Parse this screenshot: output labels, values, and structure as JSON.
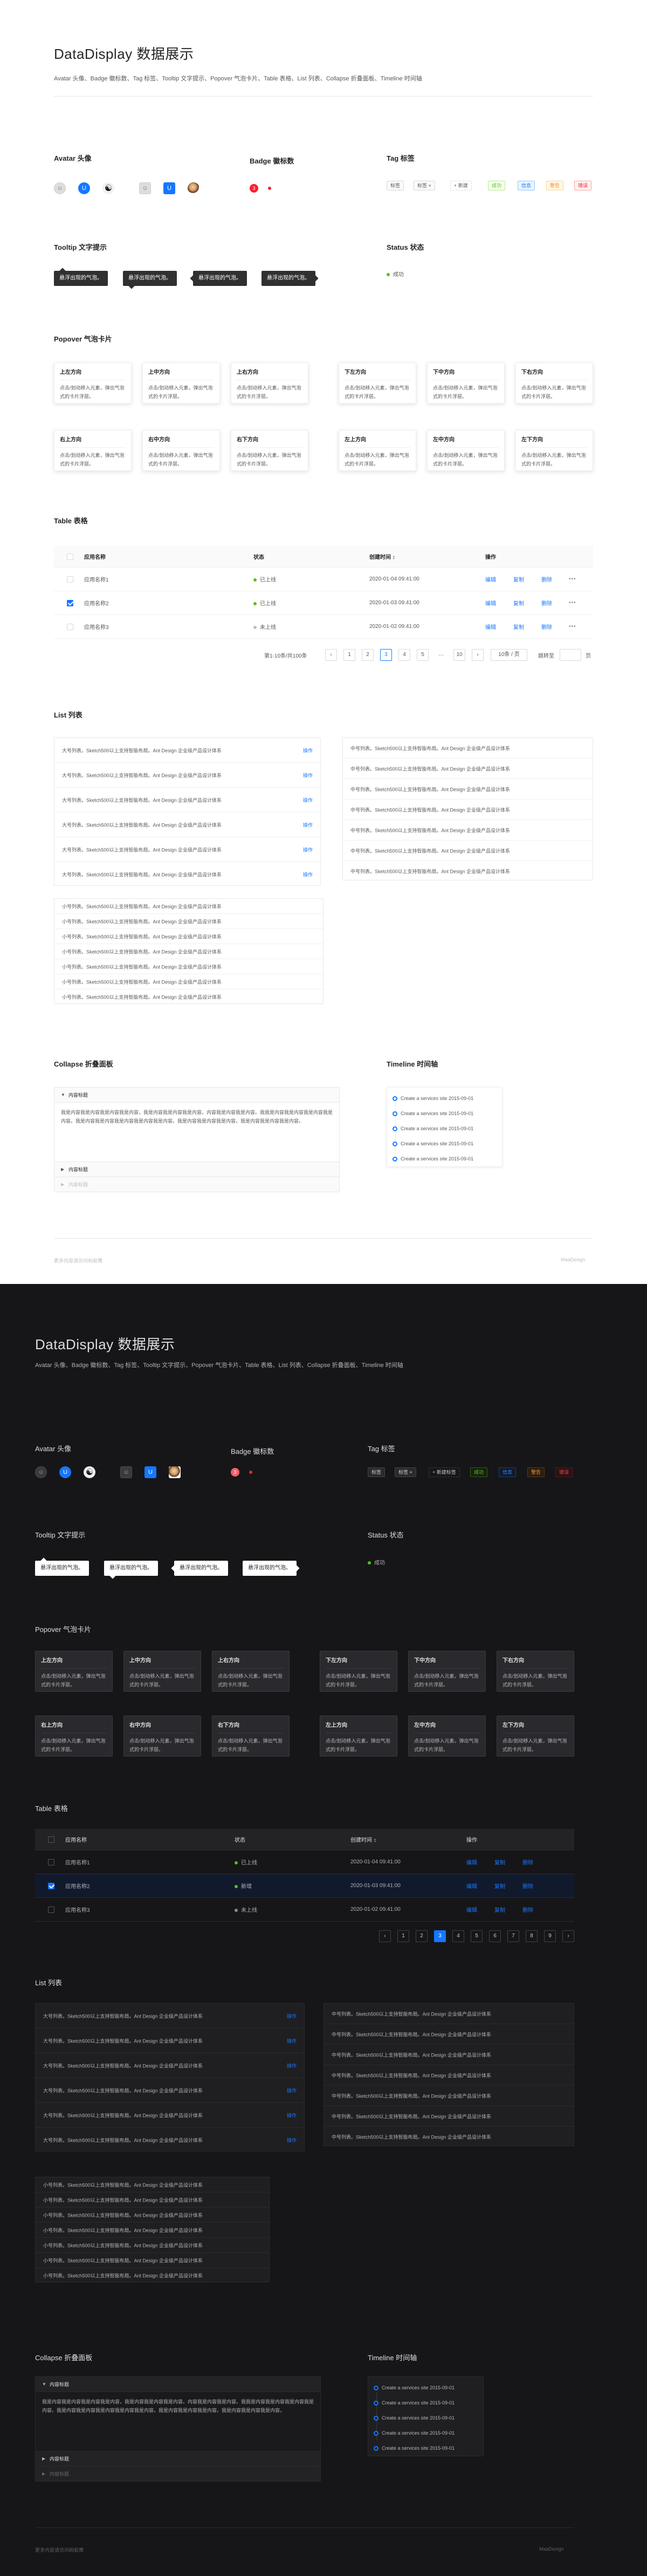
{
  "page": {
    "title": "DataDisplay 数据展示",
    "subtitle": "Avatar 头像、Badge 徽标数、Tag 标签、Tooltip 文字提示、Popover 气泡卡片、Table 表格、List 列表、Collapse 折叠面板、Timeline 时间轴"
  },
  "sections": {
    "avatar": "Avatar 头像",
    "badge": "Badge 徽标数",
    "tag": "Tag 标签",
    "tooltip": "Tooltip 文字提示",
    "status": "Status 状态",
    "popover": "Popover 气泡卡片",
    "table": "Table 表格",
    "list": "List 列表",
    "collapse": "Collapse 折叠面板",
    "timeline": "Timeline 时间轴"
  },
  "avatar": {
    "letter": "U",
    "icons": [
      "user-icon",
      "yin-yang-icon",
      "photo-avatar"
    ]
  },
  "badge": {
    "count": "3"
  },
  "tags": {
    "light": [
      "标签",
      "标签 ×",
      "+ 新建",
      "成功",
      "信息",
      "警告",
      "错误"
    ],
    "dark": [
      "标签",
      "标签 ×",
      "+ 新建标签",
      "成功",
      "信息",
      "警告",
      "错误"
    ]
  },
  "tooltip": {
    "text": "悬浮出现的气泡。"
  },
  "status": {
    "text": "成功",
    "color": "#52c41a"
  },
  "popover": {
    "titles": [
      "上左方向",
      "上中方向",
      "上右方向",
      "下左方向",
      "下中方向",
      "下右方向",
      "右上方向",
      "右中方向",
      "右下方向",
      "左上方向",
      "左中方向",
      "左下方向"
    ],
    "desc": "点击/划动移入元素，弹出气泡式的卡片浮层。"
  },
  "table": {
    "headers": [
      "应用名称",
      "状态",
      "创建时间",
      "操作"
    ],
    "sort_icon": "↕",
    "rows": [
      {
        "name": "应用名称1",
        "status": "已上线",
        "status_color": "#52c41a",
        "time": "2020-01-04  09:41:00",
        "selected": false
      },
      {
        "name": "应用名称2",
        "status": "已上线",
        "status_color": "#52c41a",
        "time": "2020-01-03  09:41:00",
        "selected": true
      },
      {
        "name": "应用名称3",
        "status": "未上线",
        "status_color": "#bfbfbf",
        "time": "2020-01-02  09:41:00",
        "selected": false
      }
    ],
    "dark_rows": [
      {
        "name": "应用名称1",
        "status": "已上线",
        "status_color": "#52c41a",
        "time": "2020-01-04  09:41:00",
        "selected": false
      },
      {
        "name": "应用名称2",
        "status": "新增",
        "status_color": "#52c41a",
        "time": "2020-01-03  09:41:00",
        "selected": true
      },
      {
        "name": "应用名称3",
        "status": "未上线",
        "status_color": "#8c8c8c",
        "time": "2020-01-02  09:41:00",
        "selected": false
      }
    ],
    "actions": [
      "编辑",
      "复制",
      "删除"
    ],
    "pagination": {
      "total": "第1-10条/共100条",
      "pages": [
        "1",
        "2",
        "3",
        "4",
        "5",
        "…",
        "10"
      ],
      "current": "3",
      "page_size": "10条 / 页",
      "jump_label": "跳转至",
      "jump_unit": "页"
    },
    "dark_pages": [
      "1",
      "2",
      "3",
      "4",
      "5",
      "6",
      "7",
      "8",
      "9"
    ],
    "dark_current": "3"
  },
  "list": {
    "big_text": "大号列表。Sketch500以上支持智能布局。Ant Design 企业级产品设计体系",
    "mid_text": "中号列表。Sketch500以上支持智能布局。Ant Design 企业级产品设计体系",
    "small_text": "小号列表。Sketch500以上支持智能布局。Ant Design 企业级产品设计体系",
    "action": "操作"
  },
  "collapse": {
    "panels": [
      "内容标题",
      "内容标题",
      "内容标题"
    ],
    "content": "我是内容我是内容我是内容我是内容，我是内容我是内容我是内容。内容我是内容我是内容。我我是内容我是内容我是内容我是内容。我是内容我是内容我是内容我是内容我是内容。我是内容我是内容我是内容。我是内容我是内容我是内容。"
  },
  "timeline": {
    "items": [
      "Create a services site 2015-09-01",
      "Create a services site 2015-09-01",
      "Create a services site 2015-09-01",
      "Create a services site 2015-09-01",
      "Create a services site 2015-09-01"
    ]
  },
  "footer": {
    "left": "更多内容请访问蚂蚁鹰",
    "right": "MaaDesign"
  }
}
